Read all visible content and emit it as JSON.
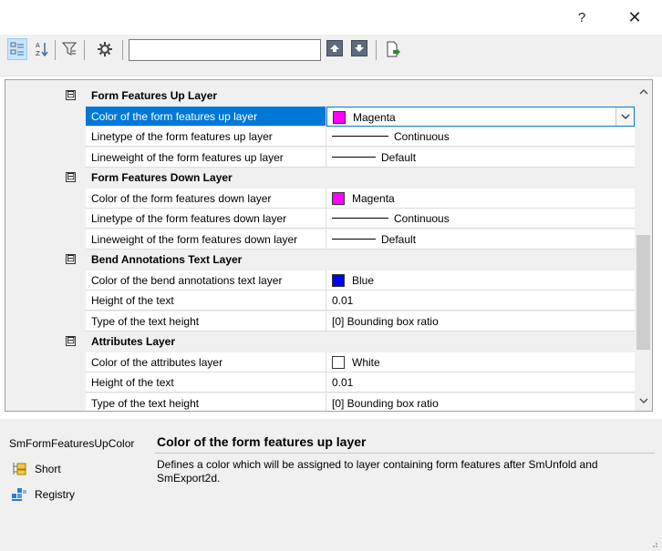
{
  "window": {
    "help_label": "?",
    "close_label": "✕"
  },
  "toolbar": {
    "search_value": "",
    "icons": [
      "categorized-view-icon",
      "alphabetical-sort-icon",
      "filter-icon",
      "settings-icon",
      "arrow-up-icon",
      "arrow-down-icon",
      "export-icon"
    ]
  },
  "grid": {
    "categories": [
      {
        "label": "Form Features Up Layer",
        "rows": [
          {
            "name": "Color of the form features up layer",
            "value": "Magenta",
            "swatch": "#ff00ff",
            "kind": "color",
            "selected": true
          },
          {
            "name": "Linetype of the form features up layer",
            "value": "Continuous",
            "kind": "line"
          },
          {
            "name": "Lineweight of the form features up layer",
            "value": "Default",
            "kind": "line-short"
          }
        ]
      },
      {
        "label": "Form Features Down Layer",
        "rows": [
          {
            "name": "Color of the form features down layer",
            "value": "Magenta",
            "swatch": "#ff00ff",
            "kind": "color"
          },
          {
            "name": "Linetype of the form features down layer",
            "value": "Continuous",
            "kind": "line"
          },
          {
            "name": "Lineweight of the form features down layer",
            "value": "Default",
            "kind": "line-short"
          }
        ]
      },
      {
        "label": "Bend Annotations Text Layer",
        "rows": [
          {
            "name": "Color of the bend annotations text layer",
            "value": "Blue",
            "swatch": "#0000ff",
            "kind": "color"
          },
          {
            "name": "Height of the text",
            "value": "0.01",
            "kind": "text"
          },
          {
            "name": "Type of the text height",
            "value": "[0] Bounding box ratio",
            "kind": "text"
          }
        ]
      },
      {
        "label": "Attributes Layer",
        "rows": [
          {
            "name": "Color of the attributes layer",
            "value": "White",
            "swatch": "#ffffff",
            "kind": "color"
          },
          {
            "name": "Height of the text",
            "value": "0.01",
            "kind": "text"
          },
          {
            "name": "Type of the text height",
            "value": "[0] Bounding box ratio",
            "kind": "text"
          }
        ]
      }
    ],
    "collapse_glyph": "⊟"
  },
  "description": {
    "variable": "SmFormFeaturesUpColor",
    "title": "Color of the form features up layer",
    "text": "Defines a color which will be assigned to layer containing form features after SmUnfold and SmExport2d.",
    "links": [
      {
        "label": "Short",
        "icon": "short-tree-icon"
      },
      {
        "label": "Registry",
        "icon": "registry-icon"
      }
    ]
  }
}
